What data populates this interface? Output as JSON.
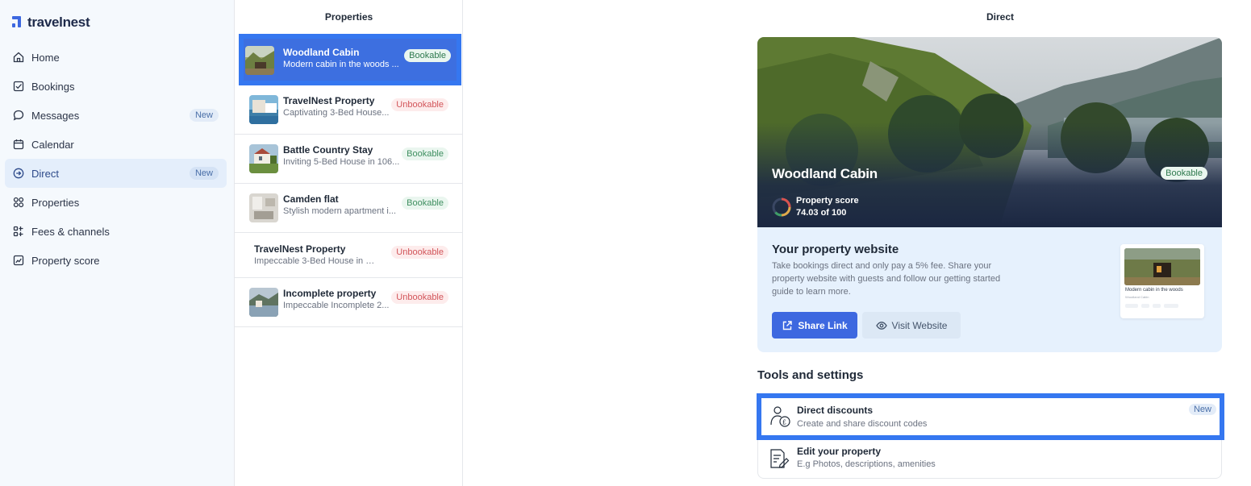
{
  "app": {
    "logo_text": "travelnest"
  },
  "sidebar": {
    "items": [
      {
        "label": "Home",
        "icon": "home-icon",
        "badge": ""
      },
      {
        "label": "Bookings",
        "icon": "calendar-check-icon",
        "badge": ""
      },
      {
        "label": "Messages",
        "icon": "chat-bubble-icon",
        "badge": "New"
      },
      {
        "label": "Calendar",
        "icon": "calendar-icon",
        "badge": ""
      },
      {
        "label": "Direct",
        "icon": "arrow-circle-icon",
        "badge": "New",
        "active": true
      },
      {
        "label": "Properties",
        "icon": "grid-icon",
        "badge": ""
      },
      {
        "label": "Fees & channels",
        "icon": "list-filter-icon",
        "badge": ""
      },
      {
        "label": "Property score",
        "icon": "chart-line-icon",
        "badge": ""
      }
    ]
  },
  "properties": {
    "title": "Properties",
    "items": [
      {
        "name": "Woodland Cabin",
        "desc": "Modern cabin in the woods ...",
        "status": "Bookable",
        "selected": true
      },
      {
        "name": "TravelNest Property",
        "desc": "Captivating 3-Bed House...",
        "status": "Unbookable"
      },
      {
        "name": "Battle Country Stay",
        "desc": "Inviting 5-Bed House in 106...",
        "status": "Bookable"
      },
      {
        "name": "Camden flat",
        "desc": "Stylish modern apartment i...",
        "status": "Bookable"
      },
      {
        "name": "TravelNest Property",
        "desc": "Impeccable 3-Bed House in Edi...",
        "status": "Unbookable",
        "no_thumb": true
      },
      {
        "name": "Incomplete property",
        "desc": "Impeccable Incomplete 2...",
        "status": "Unbookable"
      }
    ]
  },
  "direct": {
    "title": "Direct",
    "hero": {
      "name": "Woodland Cabin",
      "status": "Bookable",
      "score_label": "Property score",
      "score_value": "74.03 of 100",
      "score_fraction": 0.7403
    },
    "website": {
      "title": "Your property website",
      "description": "Take bookings direct and only pay a 5% fee. Share your property website with guests and follow our getting started guide to learn more.",
      "share_label": "Share Link",
      "visit_label": "Visit Website",
      "preview_title": "Modern cabin in the woods",
      "preview_sub": "Woodland Cabin"
    },
    "tools_title": "Tools and settings",
    "tools": [
      {
        "name": "Direct discounts",
        "desc": "Create and share discount codes",
        "badge": "New",
        "icon": "discount-person-icon"
      },
      {
        "name": "Edit your property",
        "desc": "E.g Photos, descriptions, amenities",
        "badge": "",
        "icon": "edit-document-icon"
      }
    ]
  },
  "colors": {
    "accent": "#3d68e0",
    "highlight": "#3577f0",
    "bookable": "#3f8f60",
    "unbookable": "#d2555a",
    "sidebar_bg": "#f5f9fd"
  }
}
